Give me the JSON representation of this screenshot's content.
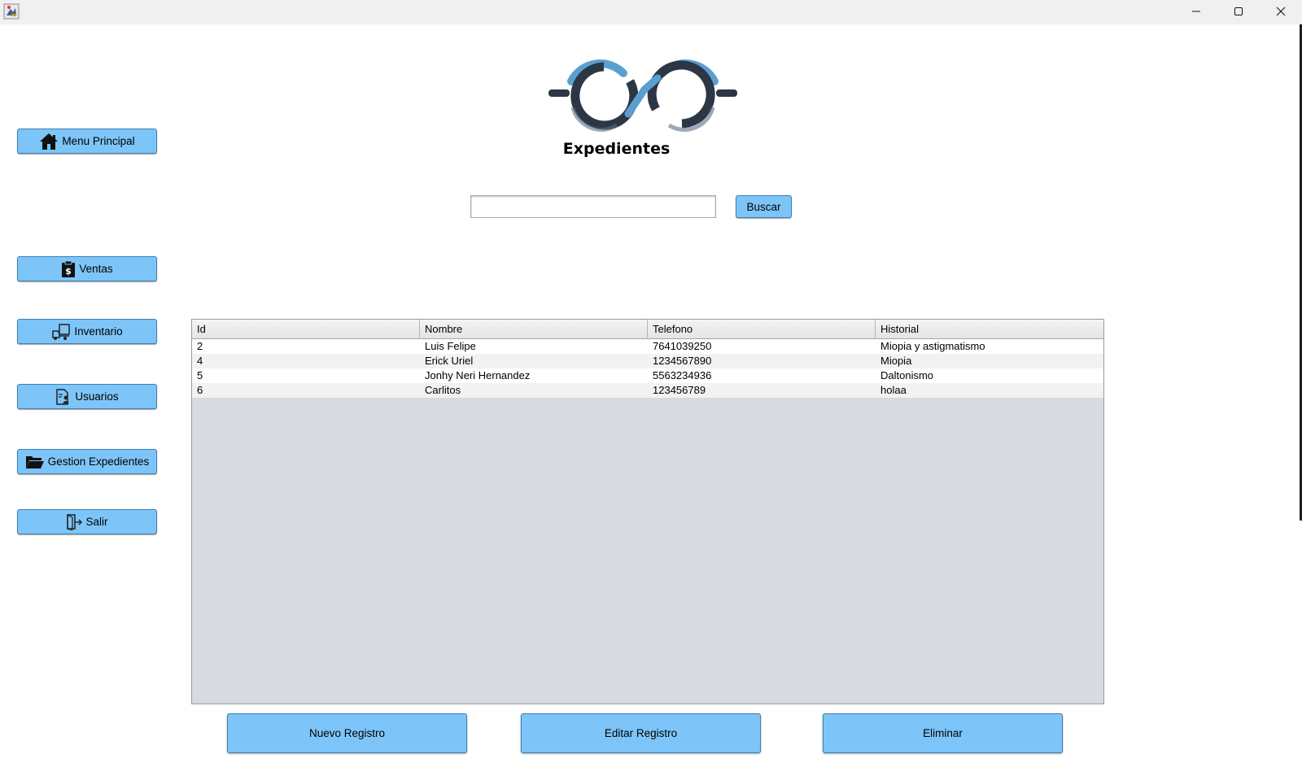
{
  "window": {
    "app_icon": "java-app-icon",
    "controls": [
      "minimize-icon",
      "maximize-icon",
      "close-icon"
    ]
  },
  "sidebar": {
    "items": [
      {
        "label": "Menu Principal",
        "icon": "home-icon"
      },
      {
        "label": "Ventas",
        "icon": "sales-clipboard-icon"
      },
      {
        "label": "Inventario",
        "icon": "delivery-truck-icon"
      },
      {
        "label": "Usuarios",
        "icon": "user-document-icon"
      },
      {
        "label": "Gestion Expedientes",
        "icon": "folder-open-icon"
      },
      {
        "label": "Salir",
        "icon": "exit-door-icon"
      }
    ]
  },
  "header": {
    "logo": "glasses-logo",
    "title": "Expedientes"
  },
  "search": {
    "value": "",
    "button_label": "Buscar"
  },
  "table": {
    "columns": [
      "Id",
      "Nombre",
      "Telefono",
      "Historial"
    ],
    "rows": [
      [
        "2",
        "Luis Felipe",
        "7641039250",
        "Miopia y astigmatismo"
      ],
      [
        "4",
        "Erick Uriel",
        "1234567890",
        "Miopia"
      ],
      [
        "5",
        "Jonhy Neri Hernandez",
        "5563234936",
        "Daltonismo"
      ],
      [
        "6",
        "Carlitos",
        "123456789",
        "holaa"
      ]
    ]
  },
  "actions": {
    "new_label": "Nuevo Registro",
    "edit_label": "Editar Registro",
    "delete_label": "Eliminar"
  },
  "colors": {
    "button_bg": "#7dc5f8",
    "button_border": "#3f7fb0",
    "logo_blue": "#5b9fd0",
    "logo_dark": "#2c3645",
    "table_empty_bg": "#d7dae0"
  }
}
